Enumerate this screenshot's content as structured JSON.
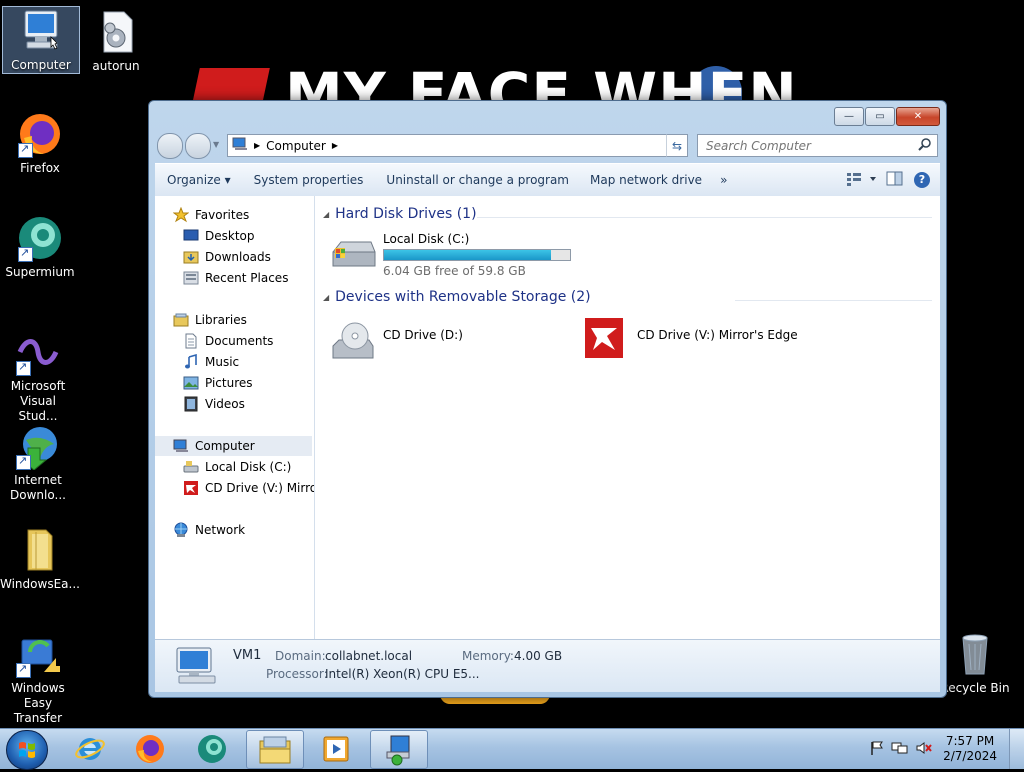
{
  "desktop": {
    "wallpaper_text": "MY FACE WHEN",
    "icons": [
      {
        "label": "Computer",
        "name": "desktop-computer-icon"
      },
      {
        "label": "autorun",
        "name": "desktop-autorun-icon"
      },
      {
        "label": "Firefox",
        "name": "desktop-firefox-icon"
      },
      {
        "label": "Supermium",
        "name": "desktop-supermium-icon"
      },
      {
        "label": "Microsoft Visual Stud...",
        "name": "desktop-visual-studio-icon"
      },
      {
        "label": "Internet Downlo...",
        "name": "desktop-internet-download-icon"
      },
      {
        "label": "WindowsEa...",
        "name": "desktop-windowseasy-folder-icon"
      },
      {
        "label": "Windows Easy Transfer",
        "name": "desktop-easy-transfer-icon"
      },
      {
        "label": "Recycle Bin",
        "name": "desktop-recycle-bin-icon"
      }
    ]
  },
  "window": {
    "buttons": {
      "minimize": "—",
      "maximize": "▭",
      "close": "✕"
    },
    "address": {
      "crumb": "Computer"
    },
    "search": {
      "placeholder": "Search Computer"
    },
    "toolbar": {
      "organize": "Organize ▾",
      "system_properties": "System properties",
      "uninstall": "Uninstall or change a program",
      "map_drive": "Map network drive",
      "more": "»"
    },
    "nav": {
      "favorites": "Favorites",
      "desktop": "Desktop",
      "downloads": "Downloads",
      "recent_places": "Recent Places",
      "libraries": "Libraries",
      "documents": "Documents",
      "music": "Music",
      "pictures": "Pictures",
      "videos": "Videos",
      "computer": "Computer",
      "local_disk": "Local Disk (C:)",
      "cd_drive": "CD Drive (V:) Mirror'",
      "network": "Network"
    },
    "content": {
      "hdd_group": "Hard Disk Drives (1)",
      "removable_group": "Devices with Removable Storage (2)",
      "local_disk": {
        "name": "Local Disk (C:)",
        "free": "6.04 GB free of 59.8 GB",
        "used_fraction": 0.899
      },
      "cd_d": {
        "name": "CD Drive (D:)"
      },
      "cd_v": {
        "name": "CD Drive (V:) Mirror's Edge"
      }
    },
    "details": {
      "computer_name": "VM1",
      "domain_label": "Domain:",
      "domain_value": "collabnet.local",
      "memory_label": "Memory:",
      "memory_value": "4.00 GB",
      "processor_label": "Processor:",
      "processor_value": "Intel(R) Xeon(R) CPU E5..."
    }
  },
  "taskbar": {
    "apps": [
      "internet-explorer",
      "firefox",
      "supermium",
      "windows-explorer",
      "media-player",
      "control-panel"
    ],
    "clock_time": "7:57 PM",
    "clock_date": "2/7/2024"
  },
  "colors": {
    "group_header": "#1e3287",
    "progress_fill": "#1a97c8",
    "taskbar": "#a6c3e2"
  }
}
